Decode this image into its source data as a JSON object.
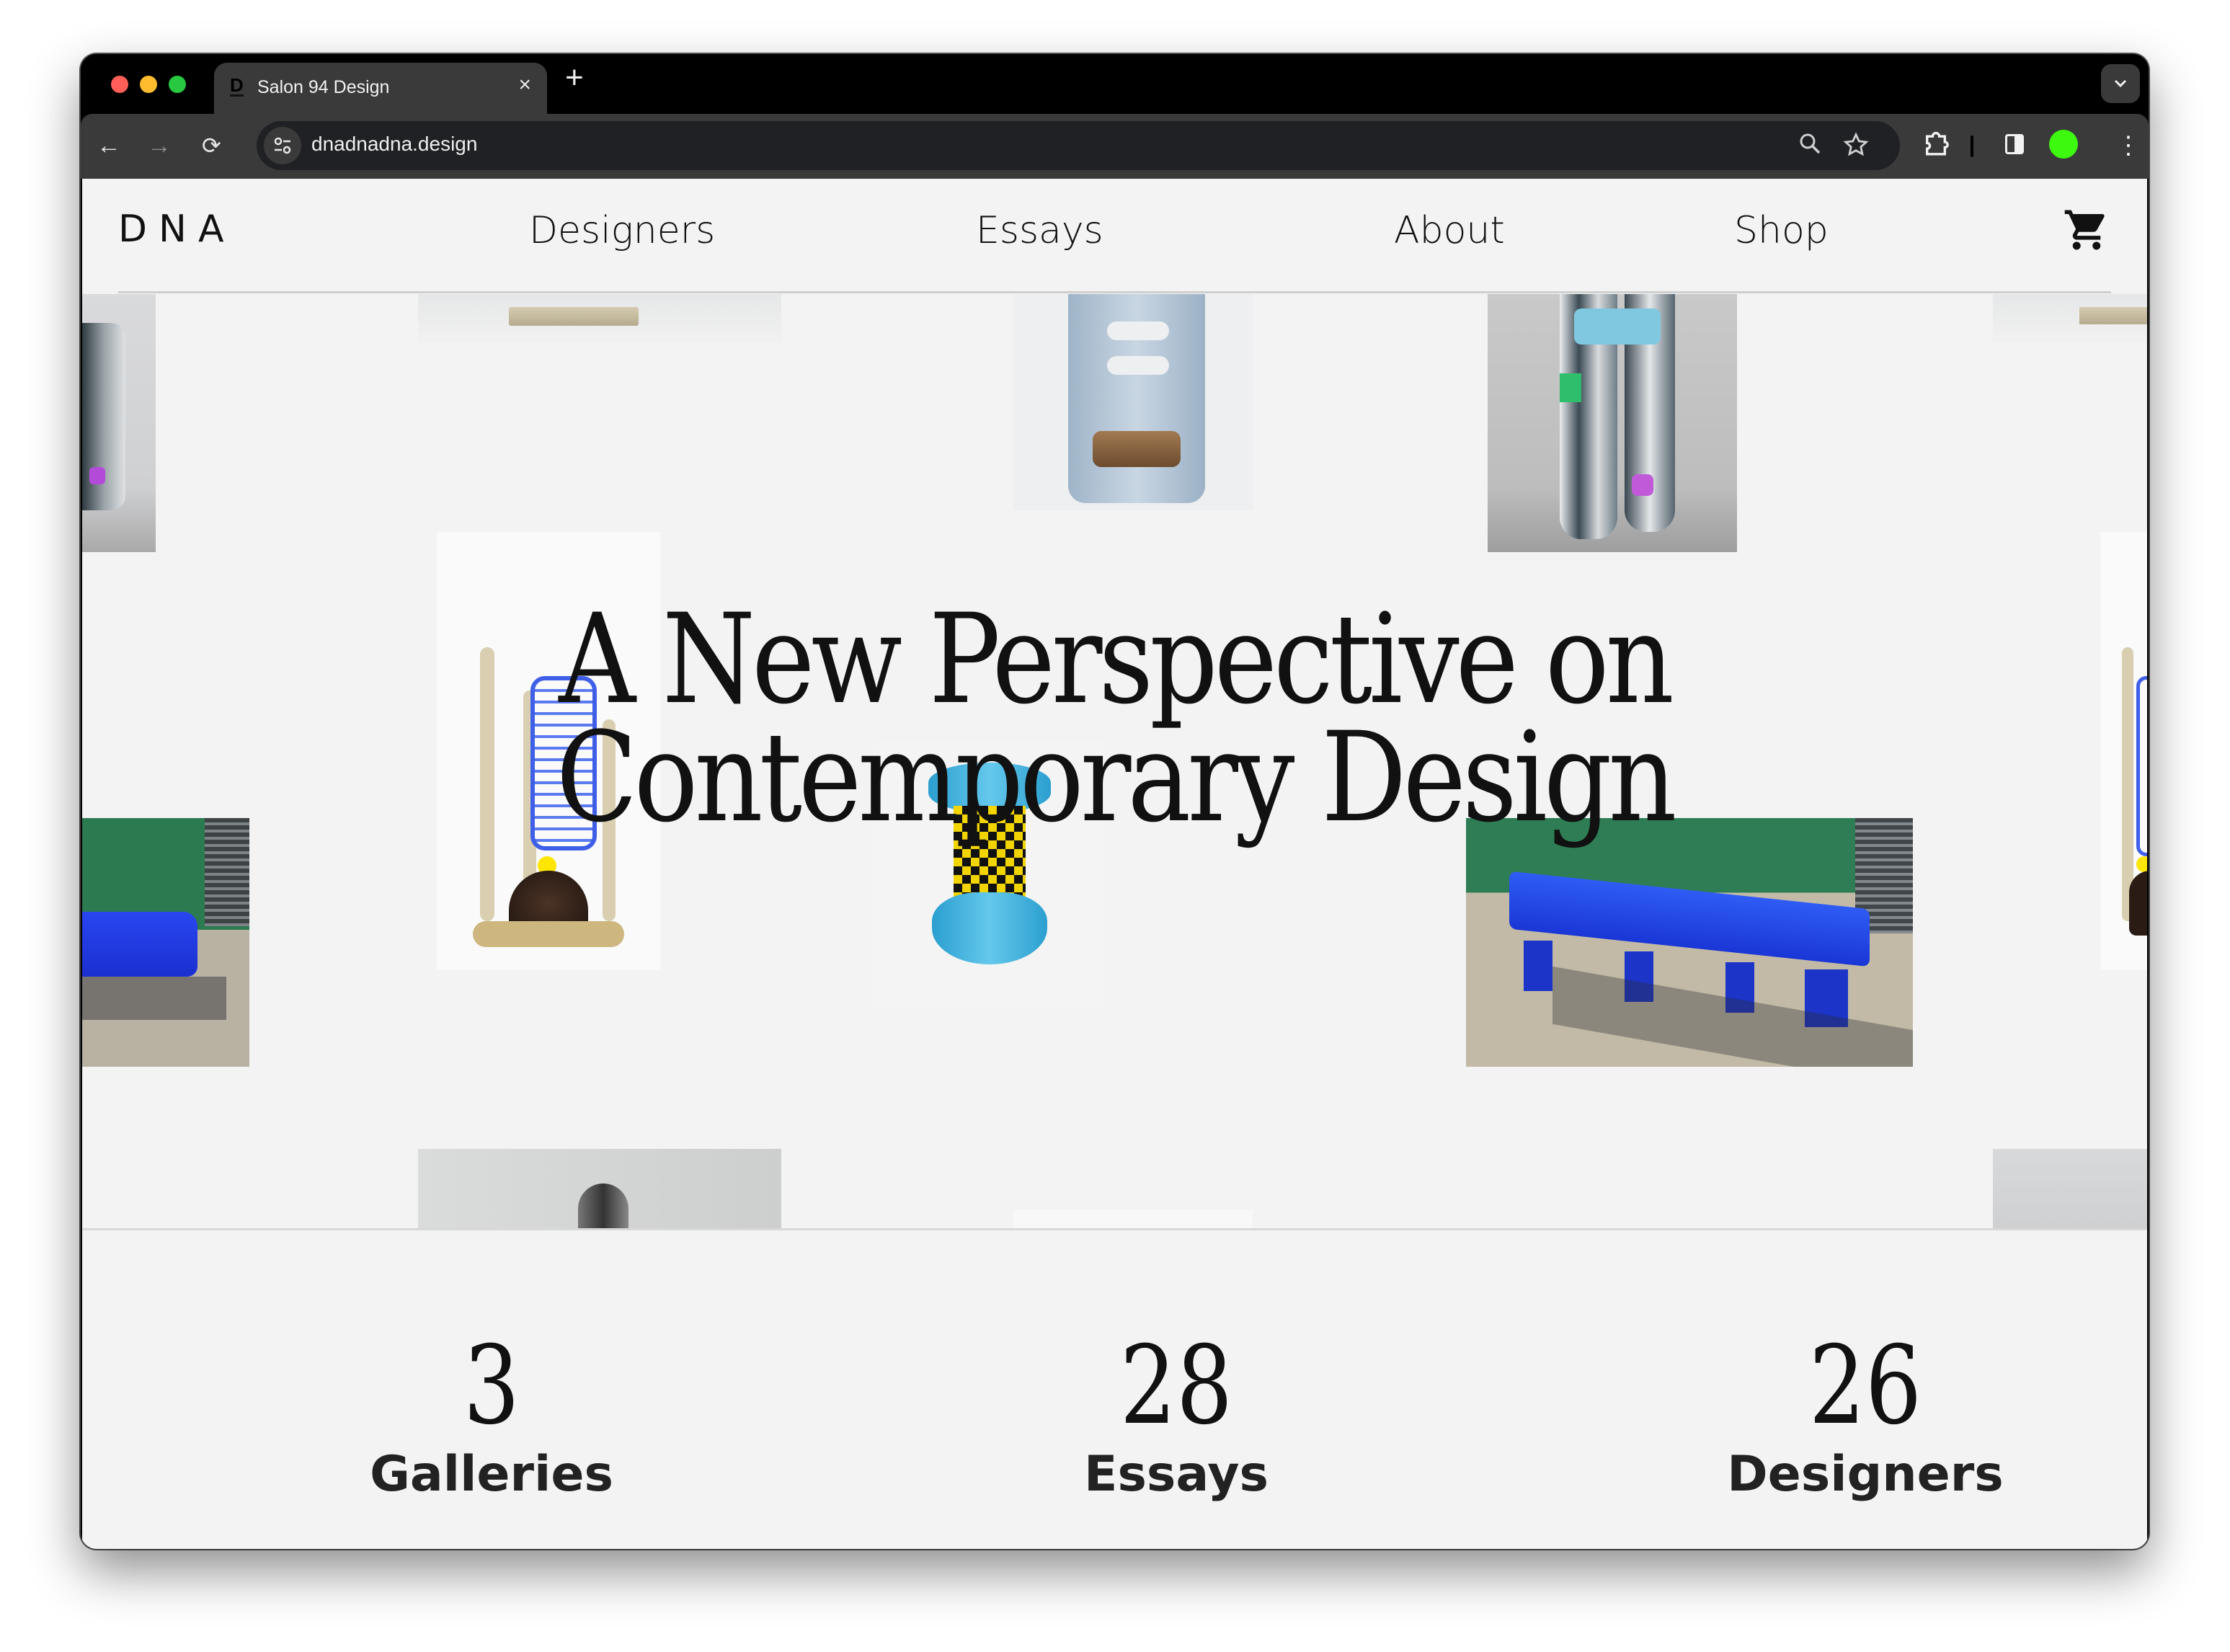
{
  "browser": {
    "tab": {
      "favicon": "D",
      "title": "Salon 94 Design",
      "close": "×"
    },
    "new_tab": "+",
    "tab_dropdown": "⌄",
    "nav": {
      "back": "←",
      "forward": "→",
      "reload": "⟳"
    },
    "url": "dnadnadna.design",
    "icons": {
      "site_info": "⚙",
      "zoom": "⌕",
      "bookmark": "☆",
      "extensions": "⧉",
      "menu": "⋮"
    },
    "profile_color": "#3df80f"
  },
  "site": {
    "logo": "DNA",
    "nav": [
      {
        "label": "Designers"
      },
      {
        "label": "Essays"
      },
      {
        "label": "About"
      },
      {
        "label": "Shop"
      }
    ],
    "cart_icon": "shopping-cart"
  },
  "hero": {
    "title_line1": "A New Perspective on",
    "title_line2": "Contemporary Design",
    "images": [
      "sculpture-legs-left",
      "wall-shelf-top",
      "ceramic-chair-blue",
      "painted-sculpture-legs",
      "wall-shelf-right",
      "cactus-neon-lamp",
      "checkered-stool-blue",
      "blue-bench-left",
      "blue-bench",
      "cactus-neon-lamp-right",
      "portrait-bottom",
      "bottom-center-tile",
      "bottom-right-tile"
    ]
  },
  "stats": [
    {
      "value": "3",
      "label": "Galleries"
    },
    {
      "value": "28",
      "label": "Essays"
    },
    {
      "value": "26",
      "label": "Designers"
    }
  ]
}
